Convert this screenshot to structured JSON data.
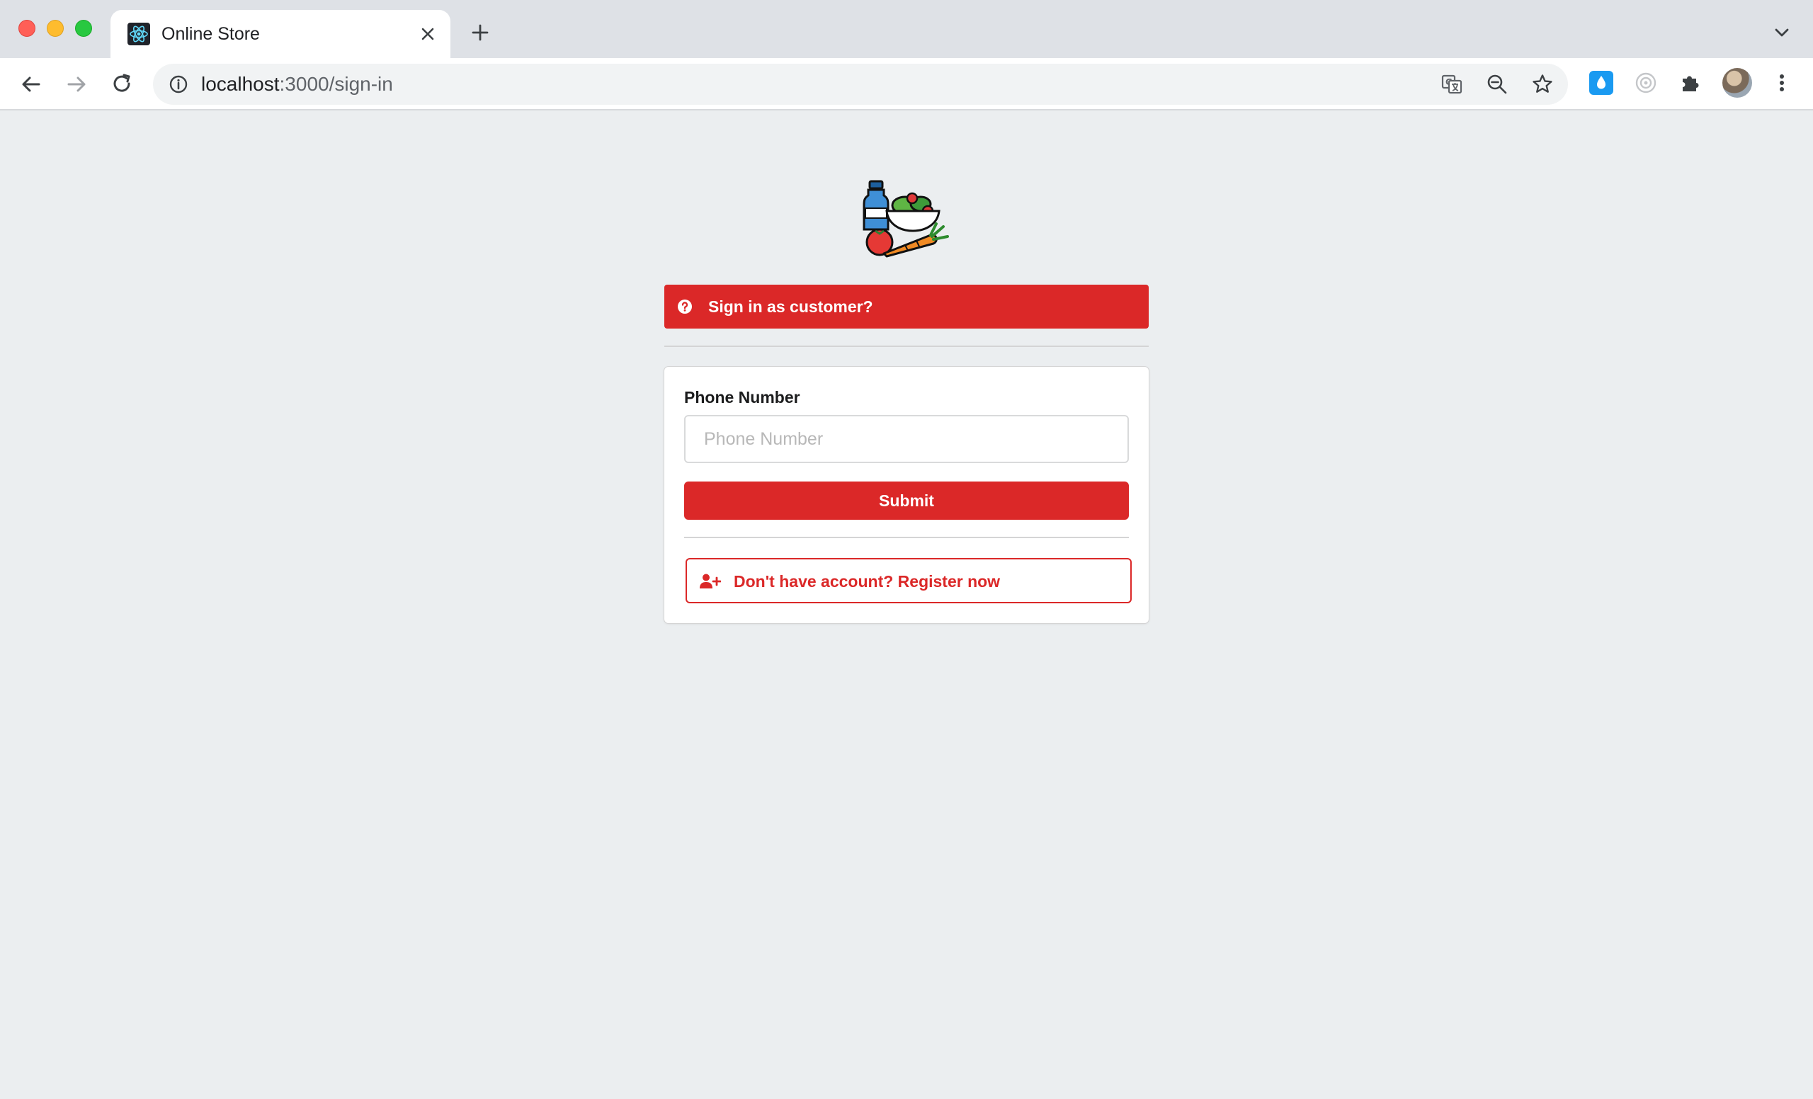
{
  "browser": {
    "tab_title": "Online Store",
    "url_host": "localhost",
    "url_path": ":3000/sign-in",
    "icons": {
      "favicon": "react-icon",
      "close": "close-icon",
      "new_tab": "plus-icon",
      "tab_menu": "chevron-down-icon",
      "back": "arrow-left-icon",
      "forward": "arrow-right-icon",
      "reload": "reload-icon",
      "info": "info-icon",
      "translate": "translate-icon",
      "zoom": "zoom-out-icon",
      "bookmark": "star-icon",
      "extension_1": "water-drop-icon",
      "extension_2": "target-icon",
      "extensions": "puzzle-icon",
      "profile": "avatar",
      "menu": "more-vertical-icon"
    }
  },
  "page": {
    "logo": "grocery-logo",
    "banner": {
      "icon": "question-circle-icon",
      "text": "Sign in as customer?"
    },
    "form": {
      "phone_label": "Phone Number",
      "phone_placeholder": "Phone Number",
      "phone_value": "",
      "submit_label": "Submit",
      "register_icon": "user-plus-icon",
      "register_label": "Don't have account? Register now"
    }
  },
  "colors": {
    "accent_red": "#db2828",
    "page_background": "#ebeef0",
    "tabbar_background": "#dee1e6"
  }
}
